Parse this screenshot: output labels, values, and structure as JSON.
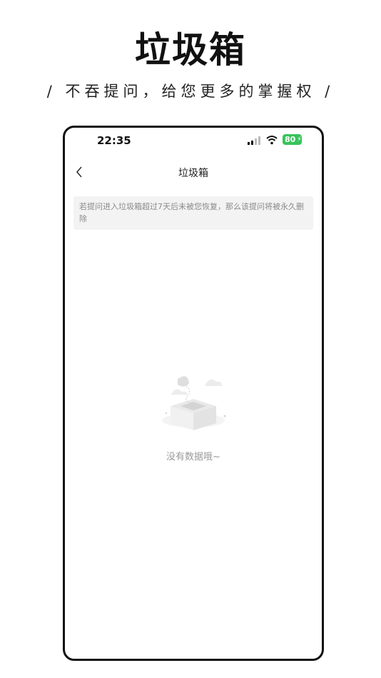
{
  "promo": {
    "title": "垃圾箱",
    "subtitle": "/ 不吞提问，给您更多的掌握权 /"
  },
  "status_bar": {
    "time": "22:35",
    "battery": "80"
  },
  "nav": {
    "title": "垃圾箱",
    "back_icon": "chevron-left-icon"
  },
  "notice": {
    "text": "若提问进入垃圾箱超过7天后未被您恢复，那么该提问将被永久删除"
  },
  "empty_state": {
    "icon": "empty-box-icon",
    "text": "没有数据哦~"
  },
  "colors": {
    "battery": "#38c35a",
    "notice_bg": "#f3f3f3",
    "muted_text": "#9a9a9a"
  }
}
